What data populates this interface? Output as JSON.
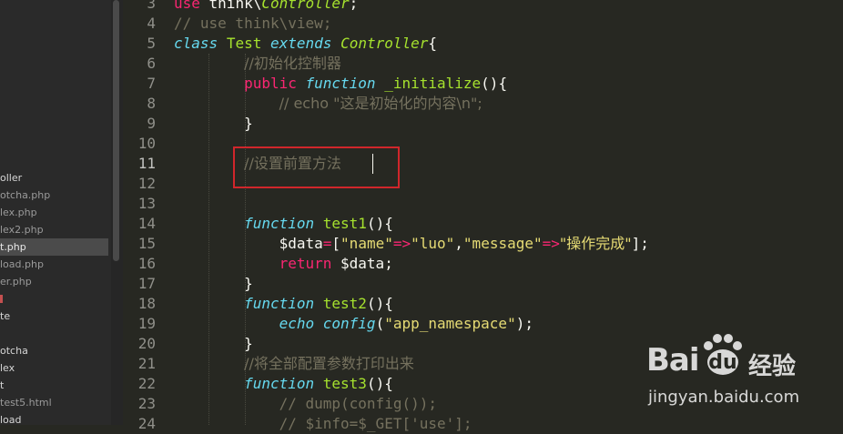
{
  "sidebar": {
    "items": [
      {
        "label": "oller",
        "style": "bright"
      },
      {
        "label": "otcha.php",
        "style": ""
      },
      {
        "label": "lex.php",
        "style": ""
      },
      {
        "label": "lex2.php",
        "style": ""
      },
      {
        "label": "t.php",
        "style": "active"
      },
      {
        "label": "load.php",
        "style": ""
      },
      {
        "label": "er.php",
        "style": ""
      },
      {
        "label": "",
        "style": "red"
      },
      {
        "label": "te",
        "style": "bright"
      },
      {
        "label": "",
        "style": ""
      },
      {
        "label": "otcha",
        "style": "bright"
      },
      {
        "label": "lex",
        "style": "bright"
      },
      {
        "label": "t",
        "style": "bright"
      },
      {
        "label": "test5.html",
        "style": ""
      },
      {
        "label": "load",
        "style": "bright"
      }
    ]
  },
  "editor": {
    "current_line": 11,
    "lines": [
      {
        "n": "3",
        "segments": [
          {
            "t": "use",
            "c": "kw"
          },
          {
            "t": " think\\",
            "c": "var"
          },
          {
            "t": "Controller",
            "c": "cls"
          },
          {
            "t": ";",
            "c": "var"
          }
        ]
      },
      {
        "n": "4",
        "segments": [
          {
            "t": "// use think\\view;",
            "c": "cm"
          }
        ]
      },
      {
        "n": "5",
        "segments": [
          {
            "t": "class",
            "c": "type"
          },
          {
            "t": " ",
            "c": "var"
          },
          {
            "t": "Test",
            "c": "fn"
          },
          {
            "t": " ",
            "c": "var"
          },
          {
            "t": "extends",
            "c": "type"
          },
          {
            "t": " ",
            "c": "var"
          },
          {
            "t": "Controller",
            "c": "cls"
          },
          {
            "t": "{",
            "c": "var"
          }
        ]
      },
      {
        "n": "6",
        "segments": [
          {
            "t": "        ",
            "c": "var"
          },
          {
            "t": "//初始化控制器",
            "c": "cm"
          }
        ]
      },
      {
        "n": "7",
        "segments": [
          {
            "t": "        ",
            "c": "var"
          },
          {
            "t": "public",
            "c": "kw"
          },
          {
            "t": " ",
            "c": "var"
          },
          {
            "t": "function",
            "c": "type"
          },
          {
            "t": " ",
            "c": "var"
          },
          {
            "t": "_initialize",
            "c": "fn"
          },
          {
            "t": "(){",
            "c": "var"
          }
        ]
      },
      {
        "n": "8",
        "segments": [
          {
            "t": "            ",
            "c": "var"
          },
          {
            "t": "// echo \"这是初始化的内容\\n\";",
            "c": "cm"
          }
        ]
      },
      {
        "n": "9",
        "segments": [
          {
            "t": "        }",
            "c": "var"
          }
        ]
      },
      {
        "n": "10",
        "segments": []
      },
      {
        "n": "11",
        "segments": [
          {
            "t": "        ",
            "c": "var"
          },
          {
            "t": "//设置前置方法",
            "c": "cm"
          }
        ]
      },
      {
        "n": "12",
        "segments": []
      },
      {
        "n": "13",
        "segments": []
      },
      {
        "n": "14",
        "segments": [
          {
            "t": "        ",
            "c": "var"
          },
          {
            "t": "function",
            "c": "type"
          },
          {
            "t": " ",
            "c": "var"
          },
          {
            "t": "test1",
            "c": "fn"
          },
          {
            "t": "(){",
            "c": "var"
          }
        ]
      },
      {
        "n": "15",
        "segments": [
          {
            "t": "            $data",
            "c": "var"
          },
          {
            "t": "=",
            "c": "kw"
          },
          {
            "t": "[",
            "c": "var"
          },
          {
            "t": "\"name\"",
            "c": "str"
          },
          {
            "t": "=>",
            "c": "kw"
          },
          {
            "t": "\"luo\"",
            "c": "str"
          },
          {
            "t": ",",
            "c": "var"
          },
          {
            "t": "\"message\"",
            "c": "str"
          },
          {
            "t": "=>",
            "c": "kw"
          },
          {
            "t": "\"操作完成\"",
            "c": "str"
          },
          {
            "t": "];",
            "c": "var"
          }
        ]
      },
      {
        "n": "16",
        "segments": [
          {
            "t": "            ",
            "c": "var"
          },
          {
            "t": "return",
            "c": "kw"
          },
          {
            "t": " $data;",
            "c": "var"
          }
        ]
      },
      {
        "n": "17",
        "segments": [
          {
            "t": "        }",
            "c": "var"
          }
        ]
      },
      {
        "n": "18",
        "segments": [
          {
            "t": "        ",
            "c": "var"
          },
          {
            "t": "function",
            "c": "type"
          },
          {
            "t": " ",
            "c": "var"
          },
          {
            "t": "test2",
            "c": "fn"
          },
          {
            "t": "(){",
            "c": "var"
          }
        ]
      },
      {
        "n": "19",
        "segments": [
          {
            "t": "            ",
            "c": "var"
          },
          {
            "t": "echo",
            "c": "type"
          },
          {
            "t": " ",
            "c": "var"
          },
          {
            "t": "config",
            "c": "type"
          },
          {
            "t": "(",
            "c": "var"
          },
          {
            "t": "\"app_namespace\"",
            "c": "str"
          },
          {
            "t": ");",
            "c": "var"
          }
        ]
      },
      {
        "n": "20",
        "segments": [
          {
            "t": "        }",
            "c": "var"
          }
        ]
      },
      {
        "n": "21",
        "segments": [
          {
            "t": "        ",
            "c": "var"
          },
          {
            "t": "//将全部配置参数打印出来",
            "c": "cm"
          }
        ]
      },
      {
        "n": "22",
        "segments": [
          {
            "t": "        ",
            "c": "var"
          },
          {
            "t": "function",
            "c": "type"
          },
          {
            "t": " ",
            "c": "var"
          },
          {
            "t": "test3",
            "c": "fn"
          },
          {
            "t": "(){",
            "c": "var"
          }
        ]
      },
      {
        "n": "23",
        "segments": [
          {
            "t": "            ",
            "c": "var"
          },
          {
            "t": "// dump(config());",
            "c": "cm"
          }
        ]
      },
      {
        "n": "24",
        "segments": [
          {
            "t": "            ",
            "c": "var"
          },
          {
            "t": "// $info=$_GET['use'];",
            "c": "cm"
          }
        ]
      }
    ]
  },
  "watermark": {
    "logo": "Bai",
    "logo_mark": "du",
    "brand": "经验",
    "url": "jingyan.baidu.com"
  }
}
